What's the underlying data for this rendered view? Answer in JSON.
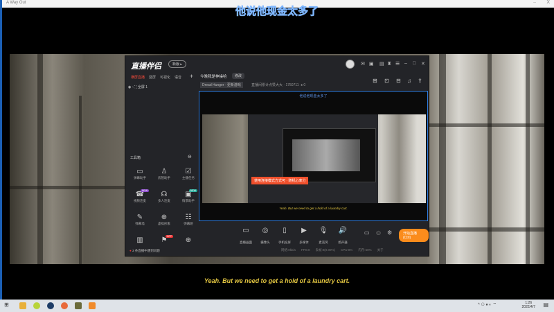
{
  "window": {
    "title": "A Way Out",
    "minimize": "–",
    "close": "X"
  },
  "subtitles": {
    "chinese": "他说他现金太多了",
    "english": "Yeah. But we need to get a hold of a laundry cart."
  },
  "app": {
    "logo": "直播伴侣",
    "version_pill": "新版 ▸",
    "header_icons": [
      "mail-icon",
      "message-icon",
      "box-icon",
      "shirt-icon",
      "menu-icon",
      "minimize-icon",
      "maximize-icon",
      "close-icon"
    ],
    "header_glyphs": [
      "✉",
      "▣",
      "▤",
      "♜",
      "☰",
      "–",
      "□",
      "✕"
    ],
    "tabs": [
      "横屏直播",
      "竖屏",
      "可视化",
      "语音"
    ],
    "scene": "全屏 1",
    "room_title": "今晚我是神操哈",
    "tag_button": "修改",
    "category": "Dread Hunger · 更新游戏",
    "fans": "直播间累计点赞大大 · 1750711",
    "likes": "0",
    "right_glyphs": [
      "⊞",
      "⊡",
      "⊟",
      "♫",
      "⇪"
    ],
    "tools_header": "工具箱",
    "tools": [
      {
        "label": "弹幕助手",
        "glyph": "▭"
      },
      {
        "label": "房管助手",
        "glyph": "♙"
      },
      {
        "label": "主播任务",
        "glyph": "☑"
      },
      {
        "label": "视频连麦",
        "glyph": "☎",
        "badge": "NEW"
      },
      {
        "label": "多人连麦",
        "glyph": "☊"
      },
      {
        "label": "情景助手",
        "glyph": "▣",
        "badge": "NEW"
      },
      {
        "label": "弹幕墙",
        "glyph": "✎"
      },
      {
        "label": "虚拟形象",
        "glyph": "⊕"
      },
      {
        "label": "弹幕姬",
        "glyph": "☷"
      },
      {
        "label": "",
        "glyph": "▥"
      },
      {
        "label": "",
        "glyph": "⚑",
        "badge": "HOT"
      },
      {
        "label": "",
        "glyph": "⊕"
      }
    ],
    "notice": "3 条直播中遇到问题",
    "preview": {
      "tip": "使用连接模式方式可 · 随机心率分",
      "inner_sub": "Yeah. But we need to get a hold of a laundry cart.",
      "inner_cn": "他说他现金太多了"
    },
    "controls": [
      {
        "label": "直播画面",
        "glyph": "▭"
      },
      {
        "label": "摄像头",
        "glyph": "◎"
      },
      {
        "label": "手机投屏",
        "glyph": "▯"
      },
      {
        "label": "多媒体",
        "glyph": "▶"
      },
      {
        "label": "麦克风",
        "glyph": "🎙"
      },
      {
        "label": "扬声器",
        "glyph": "🔊"
      }
    ],
    "start_button": "开始直播(Ctrl)",
    "status": [
      "网络:0kb/s",
      "FPS:0",
      "丢帧:0(0.00%)",
      "CPU:0%",
      "内存:50%",
      "关于"
    ]
  },
  "taskbar": {
    "time": "1:26",
    "date": "2022/4/7",
    "tray": "^ ⚇ ♦ ◐ ⌔"
  },
  "colors": {
    "accent": "#fb8c1c",
    "subtitle": "#e2c541",
    "preview_border": "#2f7de1"
  }
}
